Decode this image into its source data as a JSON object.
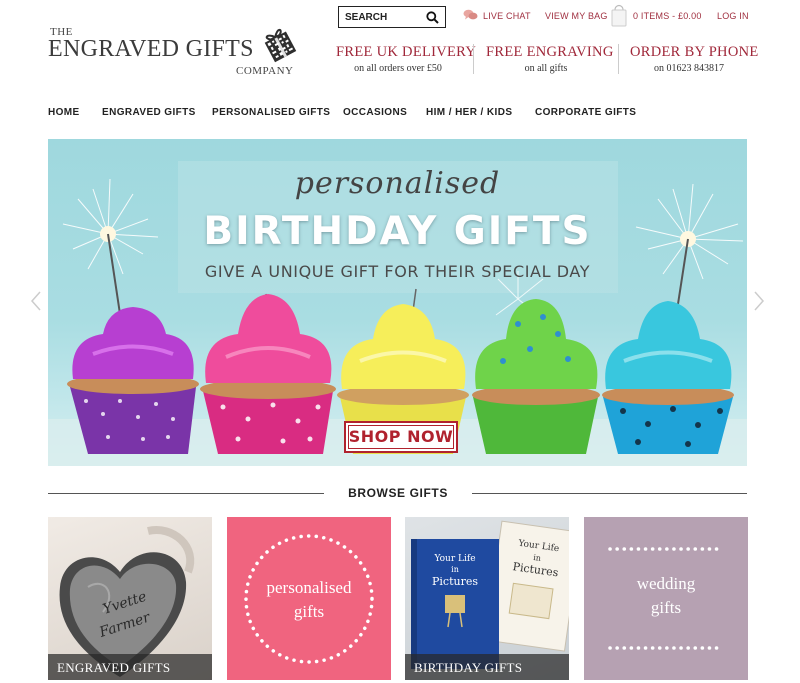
{
  "header": {
    "logo": {
      "the": "THE",
      "main": "ENGRAVED GIFTS",
      "company": "COMPANY"
    },
    "search": {
      "placeholder": "SEARCH"
    },
    "links": {
      "live_chat": "LIVE CHAT",
      "view_bag": "VIEW MY BAG",
      "bag_summary": "0 ITEMS - £0.00",
      "login": "LOG IN"
    },
    "usps": [
      {
        "title": "FREE UK DELIVERY",
        "sub": "on all orders over £50"
      },
      {
        "title": "FREE ENGRAVING",
        "sub": "on all gifts"
      },
      {
        "title": "ORDER BY PHONE",
        "sub": "on 01623 843817"
      }
    ],
    "accent_color": "#a0283a"
  },
  "nav": [
    {
      "label": "HOME"
    },
    {
      "label": "ENGRAVED GIFTS"
    },
    {
      "label": "PERSONALISED GIFTS"
    },
    {
      "label": "OCCASIONS"
    },
    {
      "label": "HIM / HER / KIDS"
    },
    {
      "label": "CORPORATE GIFTS"
    }
  ],
  "hero": {
    "kicker": "personalised",
    "title": "BIRTHDAY GIFTS",
    "subtitle": "GIVE A UNIQUE GIFT FOR THEIR SPECIAL DAY",
    "cta": "SHOP NOW",
    "prev_icon": "chevron-left-icon",
    "next_icon": "chevron-right-icon"
  },
  "browse": {
    "title": "BROWSE GIFTS",
    "tiles": [
      {
        "caption": "ENGRAVED GIFTS",
        "engraving": [
          "Yvette",
          "Farmer"
        ]
      },
      {
        "text": [
          "personalised",
          "gifts"
        ],
        "bg": "#f0647f"
      },
      {
        "caption": "BIRTHDAY GIFTS",
        "book_title": [
          "Your Life",
          "in",
          "Pictures"
        ]
      },
      {
        "text": [
          "wedding",
          "gifts"
        ],
        "bg": "#b6a1b2"
      }
    ]
  }
}
